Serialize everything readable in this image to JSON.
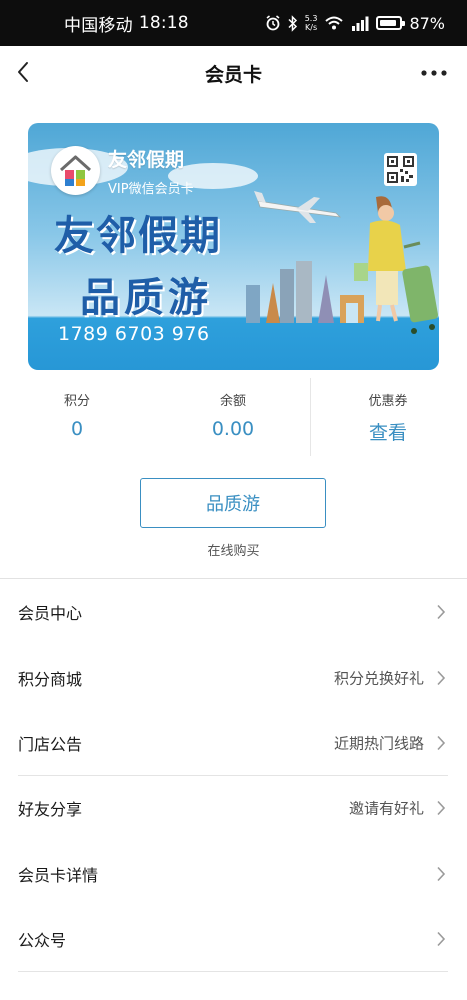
{
  "status_bar": {
    "carrier": "中国移动",
    "time": "18:18",
    "speed_value": "5.3",
    "speed_unit": "K/s",
    "battery": "87%",
    "battery_level": 0.87
  },
  "nav": {
    "title": "会员卡"
  },
  "card": {
    "brand": "友邻假期",
    "subtitle": "VIP微信会员卡",
    "headline_line1": "友邻假期",
    "headline_line2": "品质游",
    "number": "1789 6703 976"
  },
  "stats": [
    {
      "label": "积分",
      "value": "0"
    },
    {
      "label": "余额",
      "value": "0.00"
    },
    {
      "label": "优惠券",
      "value": "查看"
    }
  ],
  "buy": {
    "button_label": "品质游",
    "caption": "在线购买"
  },
  "menu": [
    {
      "label": "会员中心",
      "hint": ""
    },
    {
      "label": "积分商城",
      "hint": "积分兑换好礼"
    },
    {
      "label": "门店公告",
      "hint": "近期热门线路"
    },
    {
      "label": "好友分享",
      "hint": "邀请有好礼"
    },
    {
      "label": "会员卡详情",
      "hint": ""
    },
    {
      "label": "公众号",
      "hint": ""
    }
  ],
  "colors": {
    "accent": "#3a8fc2",
    "headline": "#1f5ea8",
    "status_bar_bg": "#0d0d0d"
  },
  "icons": [
    "back-arrow-icon",
    "more-icon",
    "alarm-icon",
    "bluetooth-icon",
    "wifi-icon",
    "signal-icon",
    "battery-icon",
    "qr-code-icon",
    "chevron-right-icon"
  ]
}
